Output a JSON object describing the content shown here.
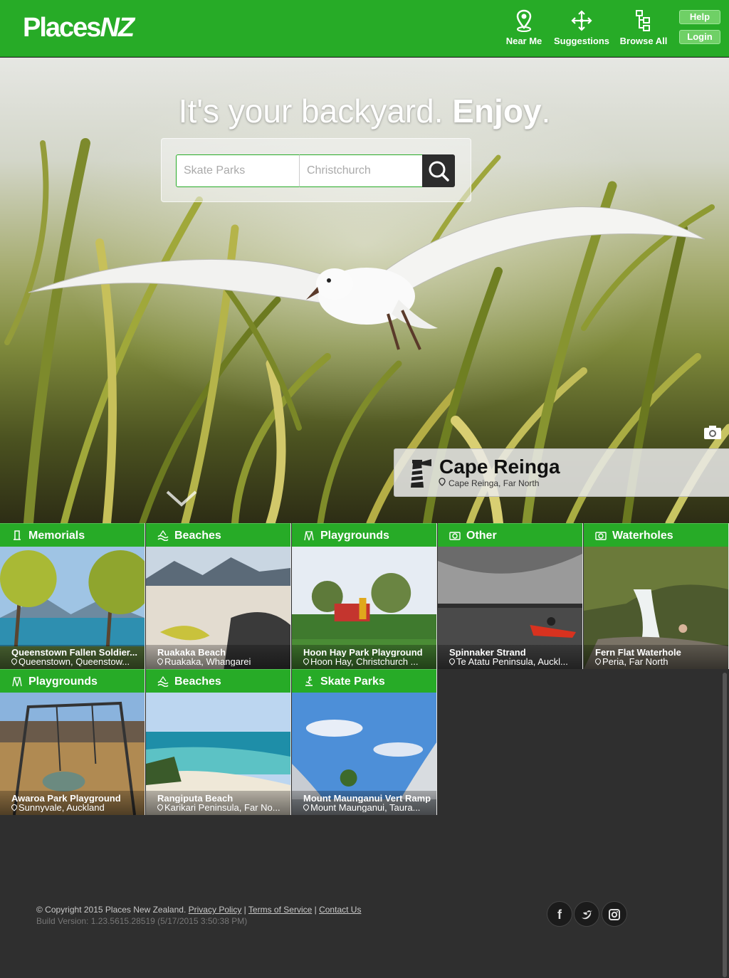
{
  "header": {
    "logo": {
      "prefix": "Places",
      "suffix": "NZ"
    },
    "nav": [
      {
        "label": "Near Me",
        "icon": "location-pin-icon"
      },
      {
        "label": "Suggestions",
        "icon": "arrows-move-icon"
      },
      {
        "label": "Browse All",
        "icon": "sitemap-icon"
      }
    ],
    "help_label": "Help",
    "login_label": "Login",
    "brand_color": "#27ab27"
  },
  "hero": {
    "tagline_light": "It's your backyard. ",
    "tagline_bold": "Enjoy",
    "tagline_end": ".",
    "search": {
      "what_placeholder": "Skate Parks",
      "where_placeholder": "Christchurch",
      "button_icon": "search-icon"
    },
    "featured": {
      "title": "Cape Reinga",
      "location": "Cape Reinga, Far North",
      "icon": "lighthouse-icon"
    },
    "camera_icon": "camera-icon",
    "scroll_icon": "chevron-down-icon"
  },
  "tiles": [
    {
      "category": "Memorials",
      "icon": "memorial-icon",
      "name": "Queenstown Fallen Soldier...",
      "location": "Queenstown, Queenstow..."
    },
    {
      "category": "Beaches",
      "icon": "waves-icon",
      "name": "Ruakaka Beach",
      "location": "Ruakaka, Whangarei"
    },
    {
      "category": "Playgrounds",
      "icon": "playground-icon",
      "name": "Hoon Hay Park Playground",
      "location": "Hoon Hay, Christchurch ..."
    },
    {
      "category": "Other",
      "icon": "camera-icon",
      "name": "Spinnaker Strand",
      "location": "Te Atatu Peninsula, Auckl..."
    },
    {
      "category": "Waterholes",
      "icon": "camera-icon",
      "name": "Fern Flat Waterhole",
      "location": "Peria, Far North"
    },
    {
      "category": "Playgrounds",
      "icon": "playground-icon",
      "name": "Awaroa Park Playground",
      "location": "Sunnyvale, Auckland"
    },
    {
      "category": "Beaches",
      "icon": "waves-icon",
      "name": "Rangiputa Beach",
      "location": "Karikari Peninsula, Far No..."
    },
    {
      "category": "Skate Parks",
      "icon": "skater-icon",
      "name": "Mount Maunganui Vert Ramp",
      "location": "Mount Maunganui, Taura..."
    }
  ],
  "footer": {
    "copyright": "© Copyright 2015 Places New Zealand.",
    "links": [
      "Privacy Policy",
      "Terms of Service",
      "Contact Us"
    ],
    "separator": "|",
    "build": "Build Version: 1.23.5615.28519 (5/17/2015 3:50:38 PM)",
    "social": [
      {
        "label": "f",
        "icon": "facebook-icon"
      },
      {
        "label": "t",
        "icon": "twitter-icon"
      },
      {
        "label": "i",
        "icon": "instagram-icon"
      }
    ]
  }
}
